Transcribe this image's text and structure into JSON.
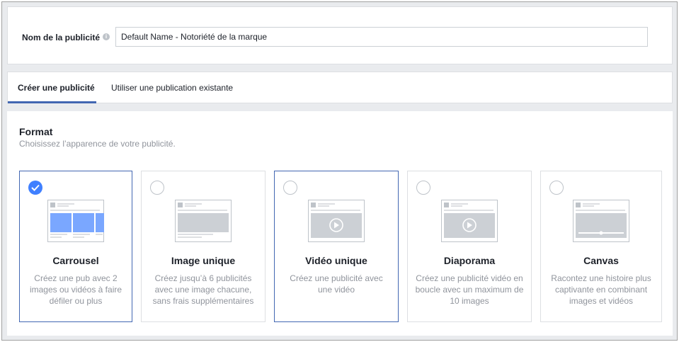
{
  "ad_name": {
    "label": "Nom de la publicité",
    "info_icon": "info-icon",
    "value": "Default Name - Notoriété de la marque"
  },
  "tabs": [
    {
      "label": "Créer une publicité",
      "active": true
    },
    {
      "label": "Utiliser une publication existante",
      "active": false
    }
  ],
  "format": {
    "title": "Format",
    "subtitle": "Choisissez l’apparence de votre publicité.",
    "options": [
      {
        "title": "Carrousel",
        "description": "Créez une pub avec 2 images ou vidéos à faire défiler ou plus",
        "selected": true
      },
      {
        "title": "Image unique",
        "description": "Créez jusqu’à 6 publicités avec une image chacune, sans frais supplémentaires",
        "selected": false
      },
      {
        "title": "Vidéo unique",
        "description": "Créez une publicité avec une vidéo",
        "selected": false
      },
      {
        "title": "Diaporama",
        "description": "Créez une publicité vidéo en boucle avec un maximum de 10 images",
        "selected": false
      },
      {
        "title": "Canvas",
        "description": "Racontez une histoire plus captivante en combinant images et vidéos",
        "selected": false
      }
    ]
  },
  "colors": {
    "accent": "#4080ff",
    "tab_underline": "#4267b2",
    "muted_text": "#90949c",
    "background": "#e9ebee"
  }
}
